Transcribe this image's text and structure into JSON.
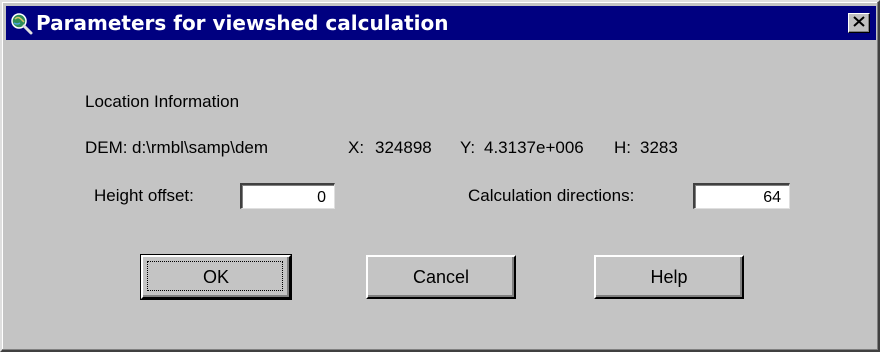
{
  "window": {
    "title": "Parameters for viewshed calculation",
    "title_icon": "magnifier-globe-icon",
    "close_icon": "close-x-icon"
  },
  "location": {
    "heading": "Location Information",
    "dem_label": "DEM:",
    "dem_value": "d:\\rmbl\\samp\\dem",
    "x_label": "X:",
    "x_value": "324898",
    "y_label": "Y:",
    "y_value": "4.3137e+006",
    "h_label": "H:",
    "h_value": "3283"
  },
  "form": {
    "height_offset_label": "Height offset:",
    "height_offset_value": "0",
    "calc_directions_label": "Calculation directions:",
    "calc_directions_value": "64"
  },
  "buttons": {
    "ok": "OK",
    "cancel": "Cancel",
    "help": "Help"
  }
}
